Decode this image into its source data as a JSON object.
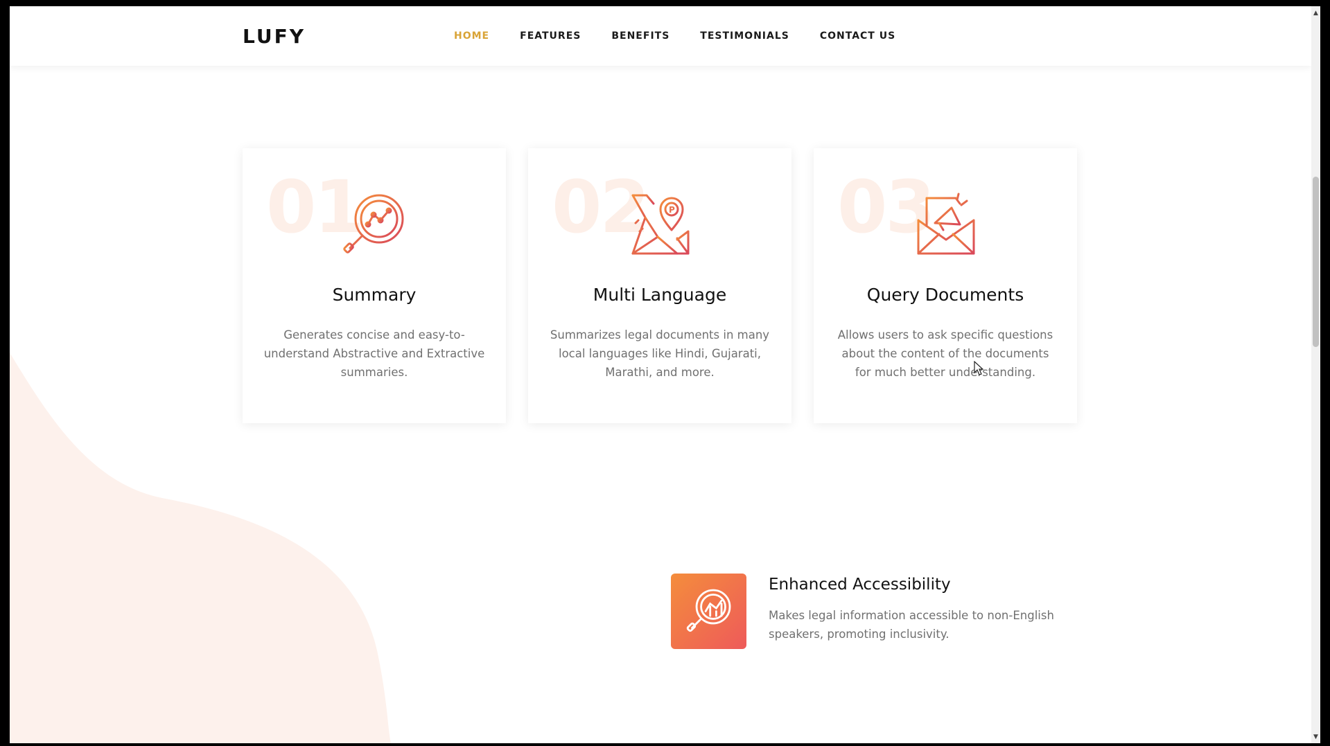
{
  "brand": {
    "logo": "LUFY"
  },
  "nav": {
    "items": [
      {
        "label": "HOME",
        "active": true
      },
      {
        "label": "FEATURES",
        "active": false
      },
      {
        "label": "BENEFITS",
        "active": false
      },
      {
        "label": "TESTIMONIALS",
        "active": false
      },
      {
        "label": "CONTACT US",
        "active": false
      }
    ]
  },
  "features": [
    {
      "number": "01",
      "icon": "chart-magnifier-icon",
      "title": "Summary",
      "description": "Generates concise and easy-to-understand Abstractive and Extractive summaries."
    },
    {
      "number": "02",
      "icon": "map-pin-icon",
      "title": "Multi Language",
      "description": "Summarizes legal documents in many local languages like Hindi, Gujarati, Marathi, and more."
    },
    {
      "number": "03",
      "icon": "envelope-megaphone-icon",
      "title": "Query Documents",
      "description": "Allows users to ask specific questions about the content of the documents for much better understanding."
    }
  ],
  "benefit": {
    "icon": "chart-magnifier-icon",
    "title": "Enhanced Accessibility",
    "description": "Makes legal information accessible to non-English speakers, promoting inclusivity."
  },
  "colors": {
    "accent": "#d9a437",
    "icon_gradient_start": "#f48d3c",
    "icon_gradient_end": "#ee5a5a",
    "number_watermark": "#fdefe8",
    "blob": "#fdf1ec"
  }
}
